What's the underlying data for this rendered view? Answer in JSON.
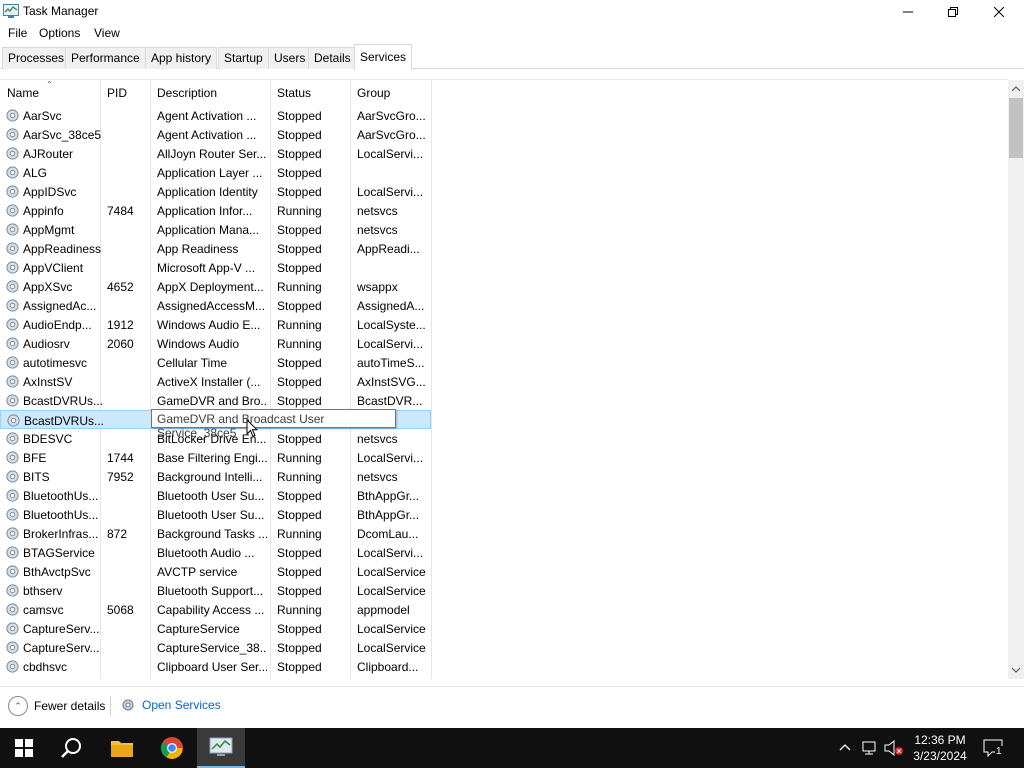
{
  "window": {
    "title": "Task Manager"
  },
  "menu": [
    "File",
    "Options",
    "View"
  ],
  "tabs": [
    {
      "label": "Processes"
    },
    {
      "label": "Performance"
    },
    {
      "label": "App history"
    },
    {
      "label": "Startup"
    },
    {
      "label": "Users"
    },
    {
      "label": "Details"
    },
    {
      "label": "Services",
      "active": true
    }
  ],
  "columns": {
    "name": "Name",
    "pid": "PID",
    "description": "Description",
    "status": "Status",
    "group": "Group"
  },
  "rows": [
    {
      "name": "AarSvc",
      "pid": "",
      "description": "Agent Activation ...",
      "status": "Stopped",
      "group": "AarSvcGro..."
    },
    {
      "name": "AarSvc_38ce5",
      "pid": "",
      "description": "Agent Activation ...",
      "status": "Stopped",
      "group": "AarSvcGro..."
    },
    {
      "name": "AJRouter",
      "pid": "",
      "description": "AllJoyn Router Ser...",
      "status": "Stopped",
      "group": "LocalServi..."
    },
    {
      "name": "ALG",
      "pid": "",
      "description": "Application Layer ...",
      "status": "Stopped",
      "group": ""
    },
    {
      "name": "AppIDSvc",
      "pid": "",
      "description": "Application Identity",
      "status": "Stopped",
      "group": "LocalServi..."
    },
    {
      "name": "Appinfo",
      "pid": "7484",
      "description": "Application Infor...",
      "status": "Running",
      "group": "netsvcs"
    },
    {
      "name": "AppMgmt",
      "pid": "",
      "description": "Application Mana...",
      "status": "Stopped",
      "group": "netsvcs"
    },
    {
      "name": "AppReadiness",
      "pid": "",
      "description": "App Readiness",
      "status": "Stopped",
      "group": "AppReadi..."
    },
    {
      "name": "AppVClient",
      "pid": "",
      "description": "Microsoft App-V ...",
      "status": "Stopped",
      "group": ""
    },
    {
      "name": "AppXSvc",
      "pid": "4652",
      "description": "AppX Deployment...",
      "status": "Running",
      "group": "wsappx"
    },
    {
      "name": "AssignedAc...",
      "pid": "",
      "description": "AssignedAccessM...",
      "status": "Stopped",
      "group": "AssignedA..."
    },
    {
      "name": "AudioEndp...",
      "pid": "1912",
      "description": "Windows Audio E...",
      "status": "Running",
      "group": "LocalSyste..."
    },
    {
      "name": "Audiosrv",
      "pid": "2060",
      "description": "Windows Audio",
      "status": "Running",
      "group": "LocalServi..."
    },
    {
      "name": "autotimesvc",
      "pid": "",
      "description": "Cellular Time",
      "status": "Stopped",
      "group": "autoTimeS..."
    },
    {
      "name": "AxInstSV",
      "pid": "",
      "description": "ActiveX Installer (...",
      "status": "Stopped",
      "group": "AxInstSVG..."
    },
    {
      "name": "BcastDVRUs...",
      "pid": "",
      "description": "GameDVR and Bro...",
      "status": "Stopped",
      "group": "BcastDVR..."
    },
    {
      "name": "BcastDVRUs...",
      "pid": "",
      "description": "",
      "status": "",
      "group": "...VR...",
      "selected": true
    },
    {
      "name": "BDESVC",
      "pid": "",
      "description": "BitLocker Drive En...",
      "status": "Stopped",
      "group": "netsvcs"
    },
    {
      "name": "BFE",
      "pid": "1744",
      "description": "Base Filtering Engi...",
      "status": "Running",
      "group": "LocalServi..."
    },
    {
      "name": "BITS",
      "pid": "7952",
      "description": "Background Intelli...",
      "status": "Running",
      "group": "netsvcs"
    },
    {
      "name": "BluetoothUs...",
      "pid": "",
      "description": "Bluetooth User Su...",
      "status": "Stopped",
      "group": "BthAppGr..."
    },
    {
      "name": "BluetoothUs...",
      "pid": "",
      "description": "Bluetooth User Su...",
      "status": "Stopped",
      "group": "BthAppGr..."
    },
    {
      "name": "BrokerInfras...",
      "pid": "872",
      "description": "Background Tasks ...",
      "status": "Running",
      "group": "DcomLau..."
    },
    {
      "name": "BTAGService",
      "pid": "",
      "description": "Bluetooth Audio ...",
      "status": "Stopped",
      "group": "LocalServi..."
    },
    {
      "name": "BthAvctpSvc",
      "pid": "",
      "description": "AVCTP service",
      "status": "Stopped",
      "group": "LocalService"
    },
    {
      "name": "bthserv",
      "pid": "",
      "description": "Bluetooth Support...",
      "status": "Stopped",
      "group": "LocalService"
    },
    {
      "name": "camsvc",
      "pid": "5068",
      "description": "Capability Access ...",
      "status": "Running",
      "group": "appmodel"
    },
    {
      "name": "CaptureServ...",
      "pid": "",
      "description": "CaptureService",
      "status": "Stopped",
      "group": "LocalService"
    },
    {
      "name": "CaptureServ...",
      "pid": "",
      "description": "CaptureService_38...",
      "status": "Stopped",
      "group": "LocalService"
    },
    {
      "name": "cbdhsvc",
      "pid": "",
      "description": "Clipboard User Ser...",
      "status": "Stopped",
      "group": "Clipboard..."
    }
  ],
  "tooltip": "GameDVR and Broadcast User Service_38ce5",
  "bottom": {
    "fewer_details": "Fewer details",
    "open_services": "Open Services"
  },
  "taskbar": {
    "time": "12:36 PM",
    "date": "3/23/2024",
    "notifications": "1"
  }
}
